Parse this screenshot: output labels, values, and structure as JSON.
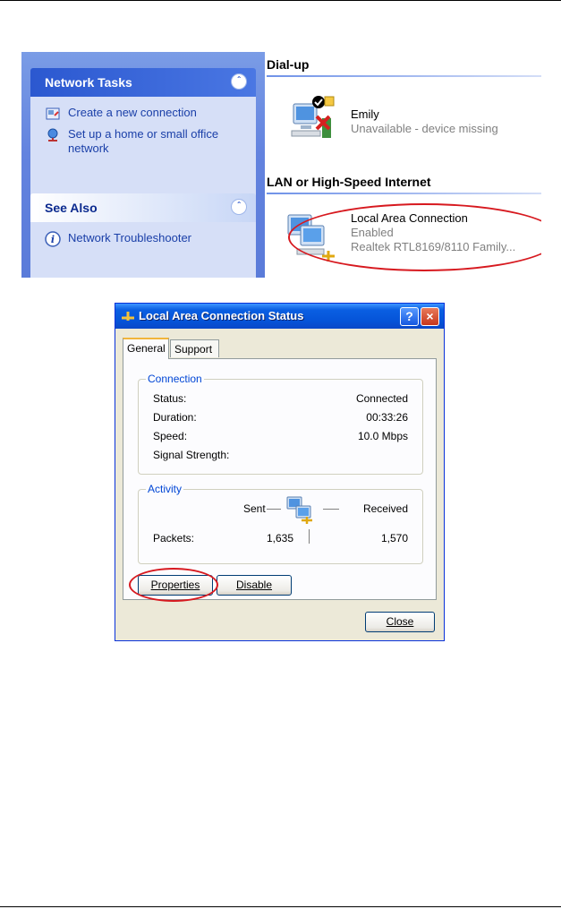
{
  "network_panel": {
    "tasks": {
      "header": "Network Tasks",
      "links": [
        "Create a new connection",
        "Set up a home or small office network"
      ]
    },
    "see_also": {
      "header": "See Also",
      "links": [
        "Network Troubleshooter"
      ]
    },
    "dialup": {
      "group_label": "Dial-up",
      "name": "Emily",
      "status": "Unavailable - device missing"
    },
    "lan": {
      "group_label": "LAN or High-Speed Internet",
      "name": "Local Area Connection",
      "status": "Enabled",
      "device": "Realtek RTL8169/8110 Family..."
    },
    "colors": {
      "task_bg": "#6383df",
      "highlight_ellipse": "#d7191f"
    }
  },
  "dialog": {
    "title": "Local Area Connection Status",
    "help_button": "?",
    "close_button": "×",
    "tabs": [
      "General",
      "Support"
    ],
    "connection": {
      "legend": "Connection",
      "rows": [
        {
          "label": "Status:",
          "value": "Connected"
        },
        {
          "label": "Duration:",
          "value": "00:33:26"
        },
        {
          "label": "Speed:",
          "value": "10.0 Mbps"
        },
        {
          "label": "Signal Strength:",
          "value": ""
        }
      ]
    },
    "activity": {
      "legend": "Activity",
      "sent_label": "Sent",
      "received_label": "Received",
      "packets_label": "Packets:",
      "packets_sent": "1,635",
      "packets_received": "1,570"
    },
    "buttons": {
      "properties": "Properties",
      "disable": "Disable",
      "close": "Close"
    }
  }
}
